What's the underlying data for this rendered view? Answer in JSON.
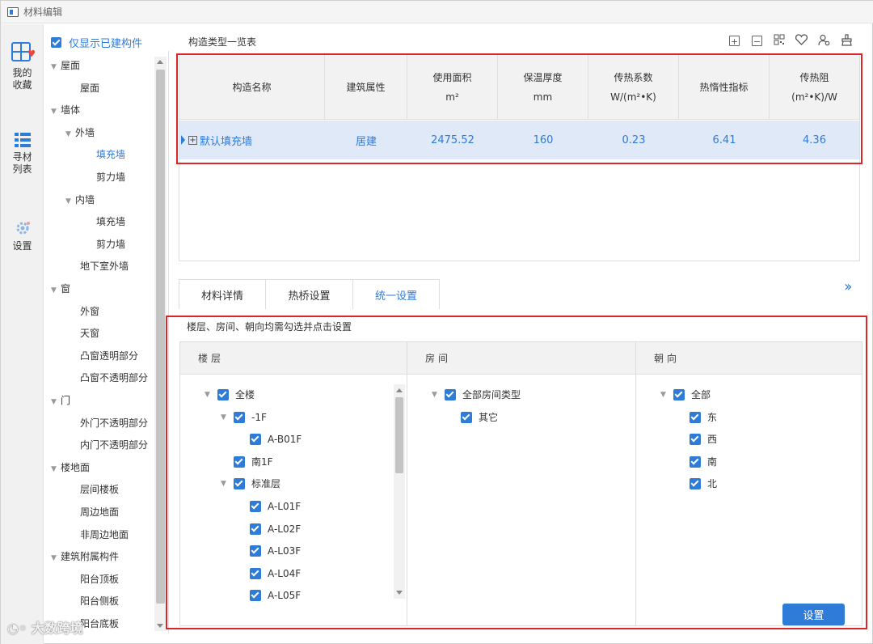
{
  "window": {
    "title": "材料编辑"
  },
  "rail": {
    "items": [
      {
        "label_line1": "我的",
        "label_line2": "收藏"
      },
      {
        "label_line1": "寻材",
        "label_line2": "列表"
      },
      {
        "label_line1": "设置"
      }
    ]
  },
  "tree": {
    "show_built_label": "仅显示已建构件",
    "nodes": [
      {
        "label": "屋面",
        "indent": 0,
        "expanded": true
      },
      {
        "label": "屋面",
        "indent": 1
      },
      {
        "label": "墙体",
        "indent": 0,
        "expanded": true
      },
      {
        "label": "外墙",
        "indent": 1,
        "expanded": true
      },
      {
        "label": "填充墙",
        "indent": 2,
        "active": true
      },
      {
        "label": "剪力墙",
        "indent": 2
      },
      {
        "label": "内墙",
        "indent": 1,
        "expanded": true
      },
      {
        "label": "填充墙",
        "indent": 2
      },
      {
        "label": "剪力墙",
        "indent": 2
      },
      {
        "label": "地下室外墙",
        "indent": 1
      },
      {
        "label": "窗",
        "indent": 0,
        "expanded": true
      },
      {
        "label": "外窗",
        "indent": 1
      },
      {
        "label": "天窗",
        "indent": 1
      },
      {
        "label": "凸窗透明部分",
        "indent": 1
      },
      {
        "label": "凸窗不透明部分",
        "indent": 1
      },
      {
        "label": "门",
        "indent": 0,
        "expanded": true
      },
      {
        "label": "外门不透明部分",
        "indent": 1
      },
      {
        "label": "内门不透明部分",
        "indent": 1
      },
      {
        "label": "楼地面",
        "indent": 0,
        "expanded": true
      },
      {
        "label": "层间楼板",
        "indent": 1
      },
      {
        "label": "周边地面",
        "indent": 1
      },
      {
        "label": "非周边地面",
        "indent": 1
      },
      {
        "label": "建筑附属构件",
        "indent": 0,
        "expanded": true
      },
      {
        "label": "阳台顶板",
        "indent": 1
      },
      {
        "label": "阳台侧板",
        "indent": 1
      },
      {
        "label": "阳台底板",
        "indent": 1
      }
    ]
  },
  "construction": {
    "title": "构造类型一览表",
    "toolbar_icons": [
      "expand-all-icon",
      "collapse-all-icon",
      "grid-icon",
      "heart-icon",
      "user-settings-icon",
      "clean-icon"
    ],
    "columns": [
      {
        "line1": "构造名称",
        "line2": ""
      },
      {
        "line1": "建筑属性",
        "line2": ""
      },
      {
        "line1": "使用面积",
        "line2": "m²"
      },
      {
        "line1": "保温厚度",
        "line2": "mm"
      },
      {
        "line1": "传热系数",
        "line2": "W/(m²•K)"
      },
      {
        "line1": "热惰性指标",
        "line2": ""
      },
      {
        "line1": "传热阻",
        "line2": "(m²•K)/W"
      }
    ],
    "rows": [
      {
        "name": "默认填充墙",
        "attribute": "居建",
        "area": "2475.52",
        "thickness": "160",
        "u_value": "0.23",
        "inertia": "6.41",
        "resistance": "4.36"
      }
    ]
  },
  "tabs": [
    {
      "label": "材料详情"
    },
    {
      "label": "热桥设置"
    },
    {
      "label": "统一设置",
      "active": true
    }
  ],
  "unified": {
    "hint": "楼层、房间、朝向均需勾选并点击设置",
    "floors": {
      "header": "楼层",
      "items": [
        {
          "label": "全楼",
          "indent": 0,
          "caret": true
        },
        {
          "label": "-1F",
          "indent": 1,
          "caret": true
        },
        {
          "label": "A-B01F",
          "indent": 2
        },
        {
          "label": "南1F",
          "indent": 1
        },
        {
          "label": "标准层",
          "indent": 1,
          "caret": true
        },
        {
          "label": "A-L01F",
          "indent": 2
        },
        {
          "label": "A-L02F",
          "indent": 2
        },
        {
          "label": "A-L03F",
          "indent": 2
        },
        {
          "label": "A-L04F",
          "indent": 2
        },
        {
          "label": "A-L05F",
          "indent": 2
        }
      ]
    },
    "rooms": {
      "header": "房间",
      "items": [
        {
          "label": "全部房间类型",
          "indent": 0,
          "caret": true
        },
        {
          "label": "其它",
          "indent": 1
        }
      ]
    },
    "orientations": {
      "header": "朝向",
      "items": [
        {
          "label": "全部",
          "indent": 0,
          "caret": true
        },
        {
          "label": "东",
          "indent": 1
        },
        {
          "label": "西",
          "indent": 1
        },
        {
          "label": "南",
          "indent": 1
        },
        {
          "label": "北",
          "indent": 1
        }
      ]
    },
    "apply_button": "设置"
  },
  "watermark": "大数跨境",
  "colors": {
    "accent": "#2f7bd8",
    "highlight_frame": "#d9262b",
    "selected_row": "#dfe9f8"
  }
}
